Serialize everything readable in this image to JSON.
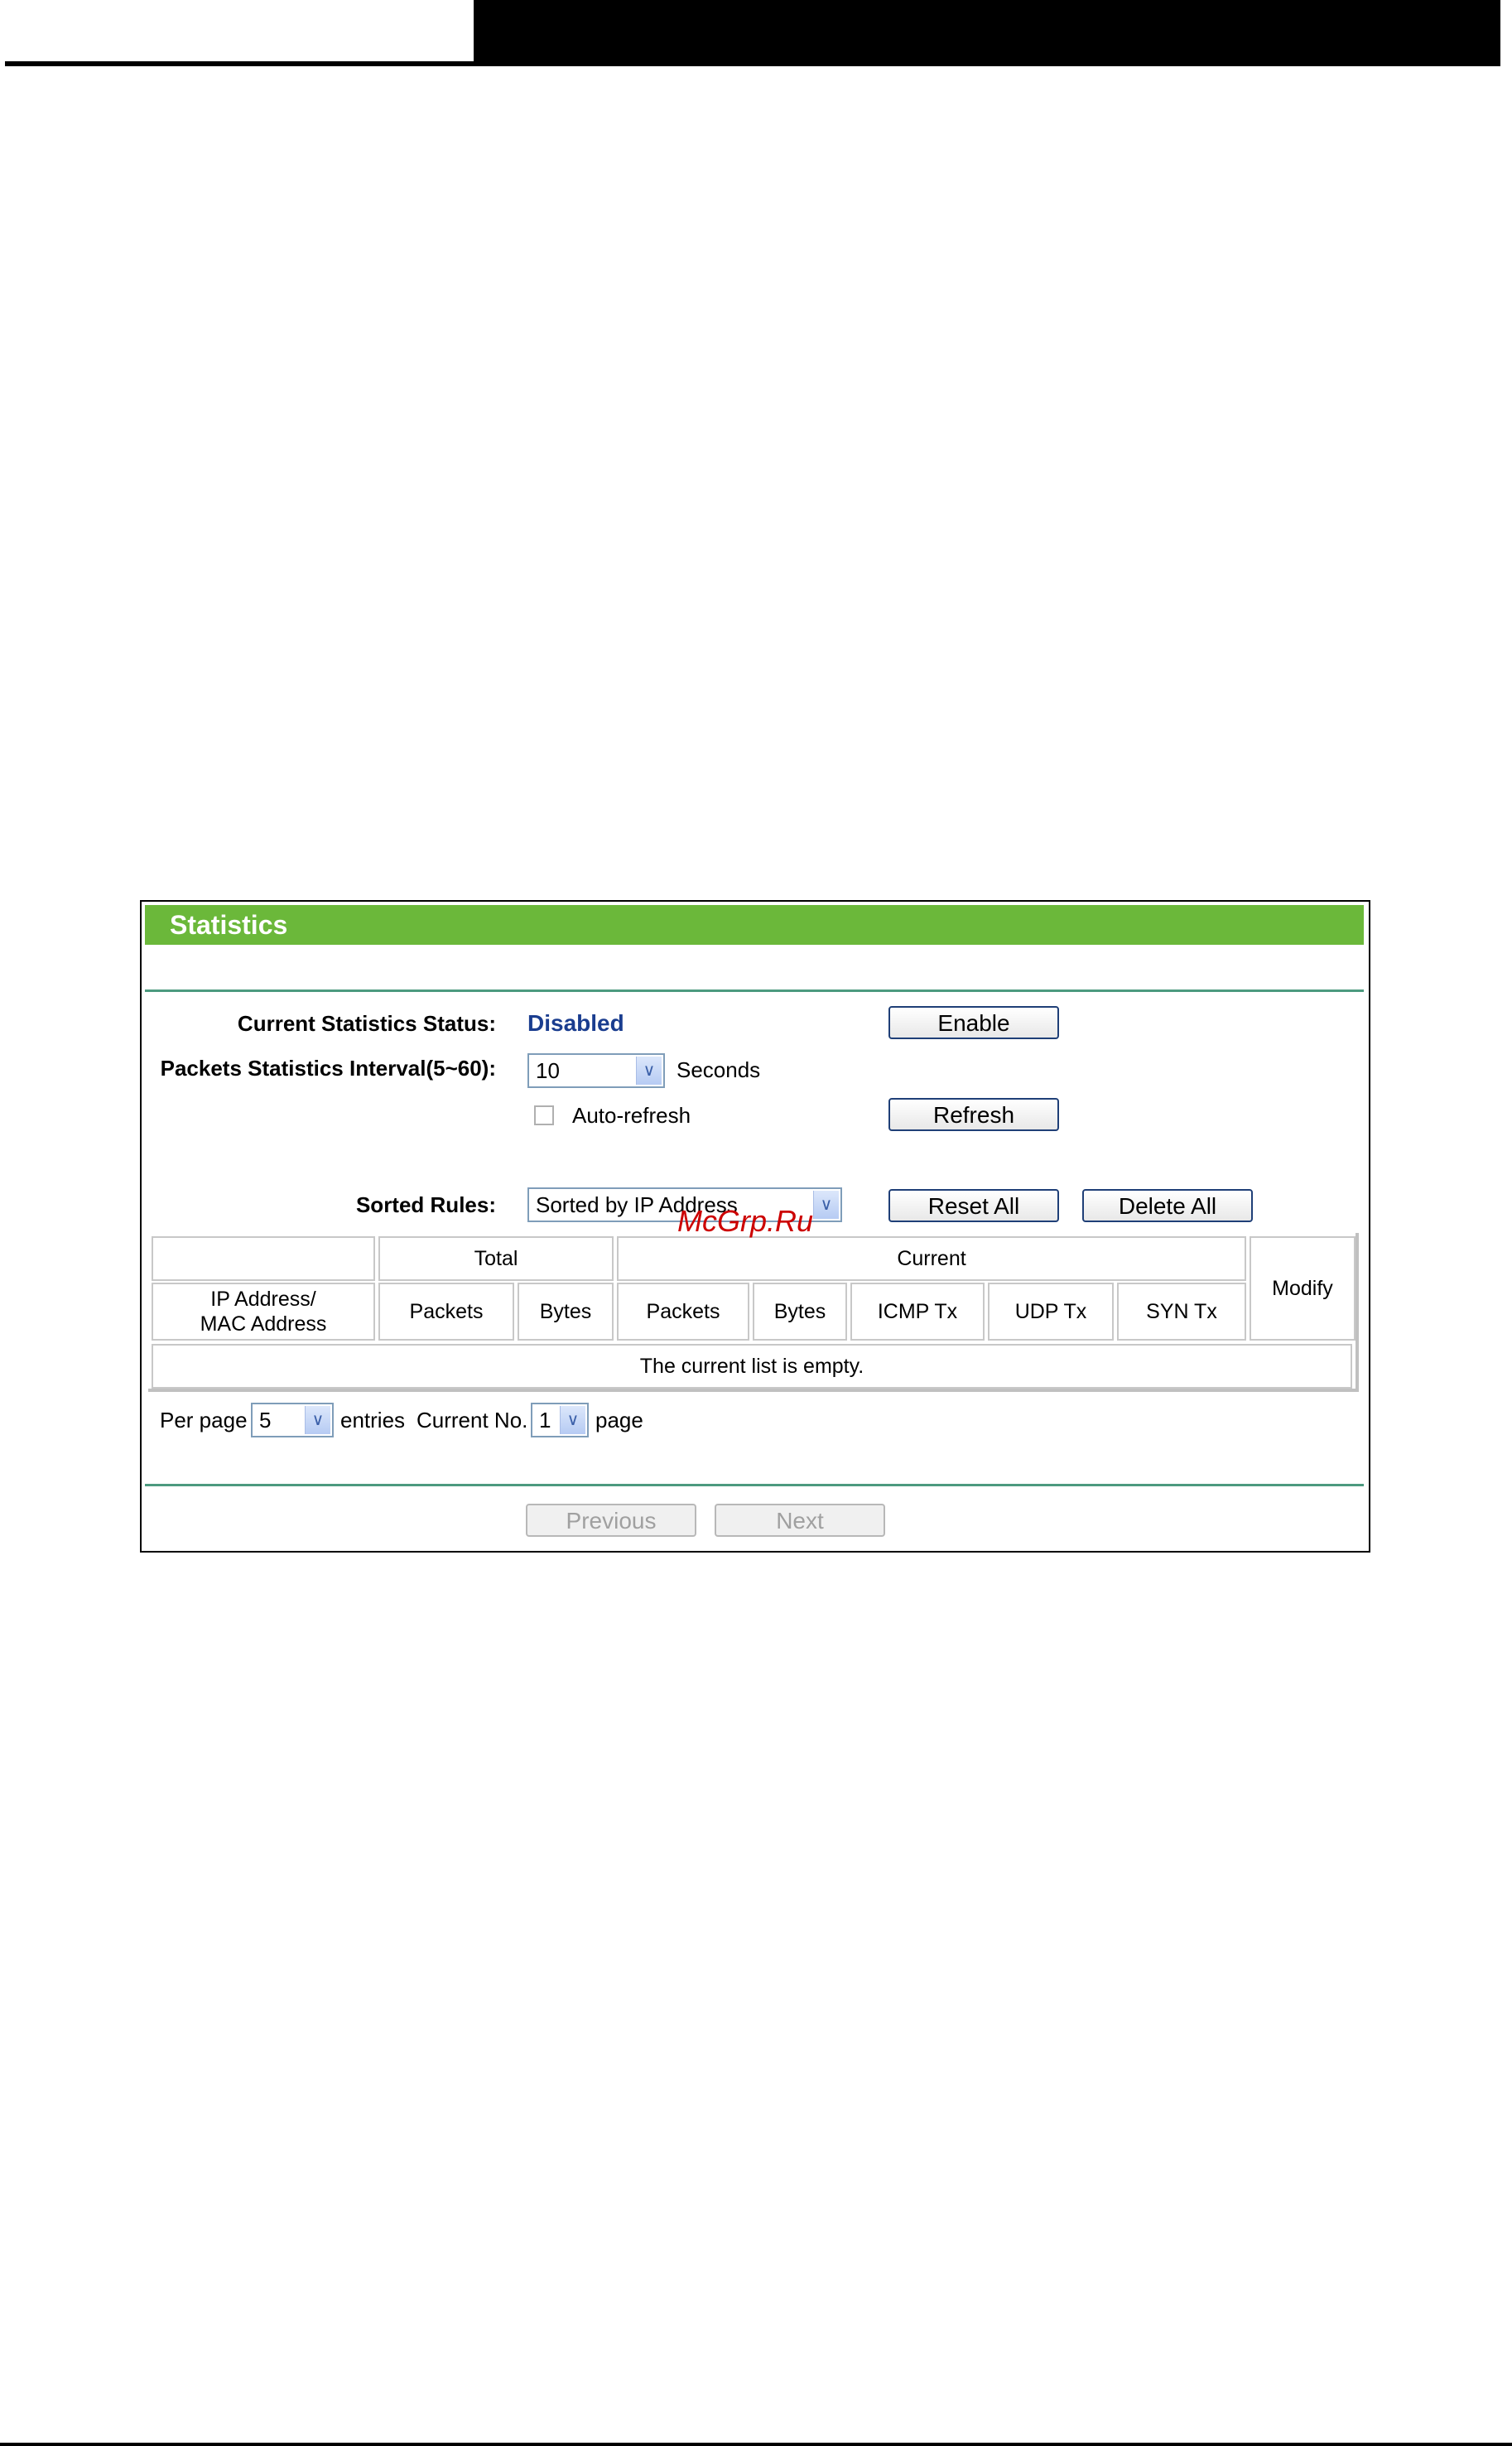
{
  "panel": {
    "title": "Statistics",
    "status_label": "Current Statistics Status:",
    "status_value": "Disabled",
    "enable_button": "Enable",
    "interval_label": "Packets Statistics Interval(5~60):",
    "interval_value": "10",
    "interval_unit": "Seconds",
    "auto_refresh_label": "Auto-refresh",
    "refresh_button": "Refresh",
    "sorted_rules_label": "Sorted Rules:",
    "sorted_rules_value": "Sorted by IP Address",
    "reset_all_button": "Reset All",
    "delete_all_button": "Delete All"
  },
  "table": {
    "group_total": "Total",
    "group_current": "Current",
    "modify": "Modify",
    "col_ip_line1": "IP Address/",
    "col_ip_line2": "MAC Address",
    "col_total_packets": "Packets",
    "col_total_bytes": "Bytes",
    "col_current_packets": "Packets",
    "col_current_bytes": "Bytes",
    "col_icmp": "ICMP Tx",
    "col_udp": "UDP Tx",
    "col_syn": "SYN Tx",
    "empty_message": "The current list is empty."
  },
  "pagination": {
    "per_page_label": "Per page",
    "per_page_value": "5",
    "entries_label": "entries",
    "current_no_label": "Current No.",
    "current_no_value": "1",
    "page_label": "page",
    "previous_button": "Previous",
    "next_button": "Next"
  },
  "watermark": "McGrp.Ru"
}
